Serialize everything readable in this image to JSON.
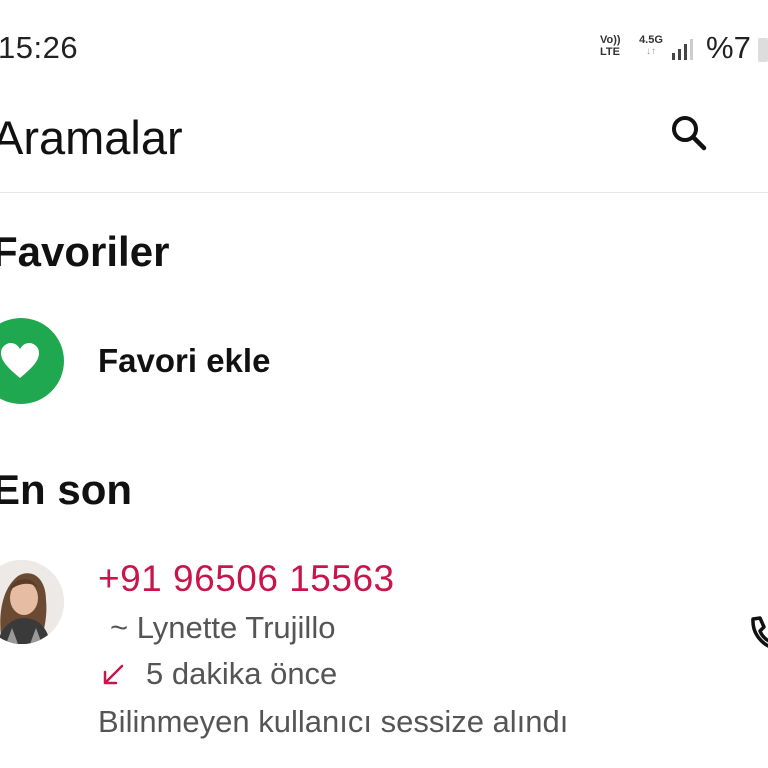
{
  "status_bar": {
    "time": "15:26",
    "volte_top": "Vo))",
    "volte_bottom": "LTE",
    "network_type": "4.5G",
    "battery": "%7"
  },
  "app_bar": {
    "title": "Aramalar"
  },
  "favorites": {
    "heading": "Favoriler",
    "add_label": "Favori ekle"
  },
  "recent": {
    "heading": "En son",
    "items": [
      {
        "number": "+91 96506 15563",
        "name": "~ Lynette Trujillo",
        "time": "5 dakika önce",
        "note": "Bilinmeyen kullanıcı sessize alındı"
      }
    ]
  },
  "colors": {
    "accent_green": "#1fa84f",
    "missed_call_red": "#c8164c"
  },
  "icons": {
    "search": "search-icon",
    "heart": "heart-icon",
    "incoming_call": "incoming-call-arrow-icon",
    "phone": "phone-icon"
  }
}
